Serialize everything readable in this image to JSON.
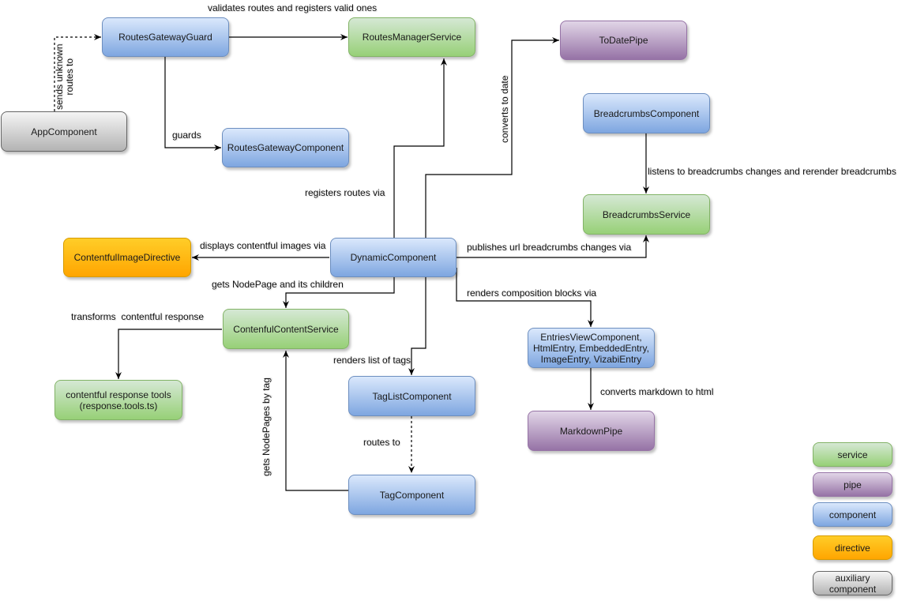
{
  "diagram": {
    "nodes": {
      "routes_gateway_guard": {
        "label": "RoutesGatewayGuard",
        "kind": "component"
      },
      "routes_manager_service": {
        "label": "RoutesManagerService",
        "kind": "service"
      },
      "to_date_pipe": {
        "label": "ToDatePipe",
        "kind": "pipe"
      },
      "app_component": {
        "label": "AppComponent",
        "kind": "auxiliary component"
      },
      "routes_gateway_component": {
        "label": "RoutesGatewayComponent",
        "kind": "component"
      },
      "breadcrumbs_component": {
        "label": "BreadcrumbsComponent",
        "kind": "component"
      },
      "breadcrumbs_service": {
        "label": "BreadcrumbsService",
        "kind": "service"
      },
      "contentful_image_directive": {
        "label": "ContentfulImageDirective",
        "kind": "directive"
      },
      "dynamic_component": {
        "label": "DynamicComponent",
        "kind": "component"
      },
      "contentful_content_service": {
        "label": "ContenfulContentService",
        "kind": "service"
      },
      "response_tools": {
        "label": "contentful response tools\n(response.tools.ts)",
        "kind": "service"
      },
      "entries_view_component": {
        "label": "EntriesViewComponent,\nHtmlEntry, EmbeddedEntry,\nImageEntry, VizabiEntry",
        "kind": "component"
      },
      "tag_list_component": {
        "label": "TagListComponent",
        "kind": "component"
      },
      "markdown_pipe": {
        "label": "MarkdownPipe",
        "kind": "pipe"
      },
      "tag_component": {
        "label": "TagComponent",
        "kind": "component"
      }
    },
    "edges": {
      "validates_routes": {
        "from": "RoutesGatewayGuard",
        "to": "RoutesManagerService",
        "label": "validates routes and registers valid ones",
        "style": "solid"
      },
      "sends_unknown": {
        "from": "AppComponent",
        "to": "RoutesGatewayGuard",
        "label": "sends unknown\nroutes to",
        "style": "dashed"
      },
      "guards": {
        "from": "RoutesGatewayGuard",
        "to": "RoutesGatewayComponent",
        "label": "guards",
        "style": "solid"
      },
      "registers_routes": {
        "from": "DynamicComponent",
        "to": "RoutesManagerService",
        "label": "registers routes via",
        "style": "solid"
      },
      "converts_to_date": {
        "from": "DynamicComponent",
        "to": "ToDatePipe",
        "label": "converts to date",
        "style": "solid"
      },
      "listens_breadcrumbs": {
        "from": "BreadcrumbsComponent",
        "to": "BreadcrumbsService",
        "label": "listens to breadcrumbs changes and rerender breadcrumbs",
        "style": "solid"
      },
      "displays_images": {
        "from": "DynamicComponent",
        "to": "ContentfulImageDirective",
        "label": "displays contentful images via",
        "style": "solid"
      },
      "publishes_breadcrumbs": {
        "from": "DynamicComponent",
        "to": "BreadcrumbsService",
        "label": "publishes url breadcrumbs changes via",
        "style": "solid"
      },
      "gets_nodepage": {
        "from": "DynamicComponent",
        "to": "ContenfulContentService",
        "label": "gets NodePage and its children",
        "style": "solid"
      },
      "renders_blocks": {
        "from": "DynamicComponent",
        "to": "EntriesViewComponent",
        "label": "renders composition blocks via",
        "style": "solid"
      },
      "transforms_response": {
        "from": "ContenfulContentService",
        "to": "contentful response tools",
        "label": "transforms  contentful response",
        "style": "solid"
      },
      "renders_tags": {
        "from": "DynamicComponent",
        "to": "TagListComponent",
        "label": "renders list of tags",
        "style": "solid"
      },
      "converts_markdown": {
        "from": "EntriesViewComponent",
        "to": "MarkdownPipe",
        "label": "converts markdown to html",
        "style": "solid"
      },
      "routes_to": {
        "from": "TagListComponent",
        "to": "TagComponent",
        "label": "routes to",
        "style": "dashed"
      },
      "gets_by_tag": {
        "from": "TagComponent",
        "to": "ContenfulContentService",
        "label": "gets NodePages by tag",
        "style": "solid"
      }
    },
    "legend": [
      {
        "label": "service",
        "color": "#97d077"
      },
      {
        "label": "pipe",
        "color": "#9673a6"
      },
      {
        "label": "component",
        "color": "#7ea6e0"
      },
      {
        "label": "directive",
        "color": "#ffa500"
      },
      {
        "label": "auxiliary\ncomponent",
        "color": "#b3b3b3"
      }
    ]
  }
}
